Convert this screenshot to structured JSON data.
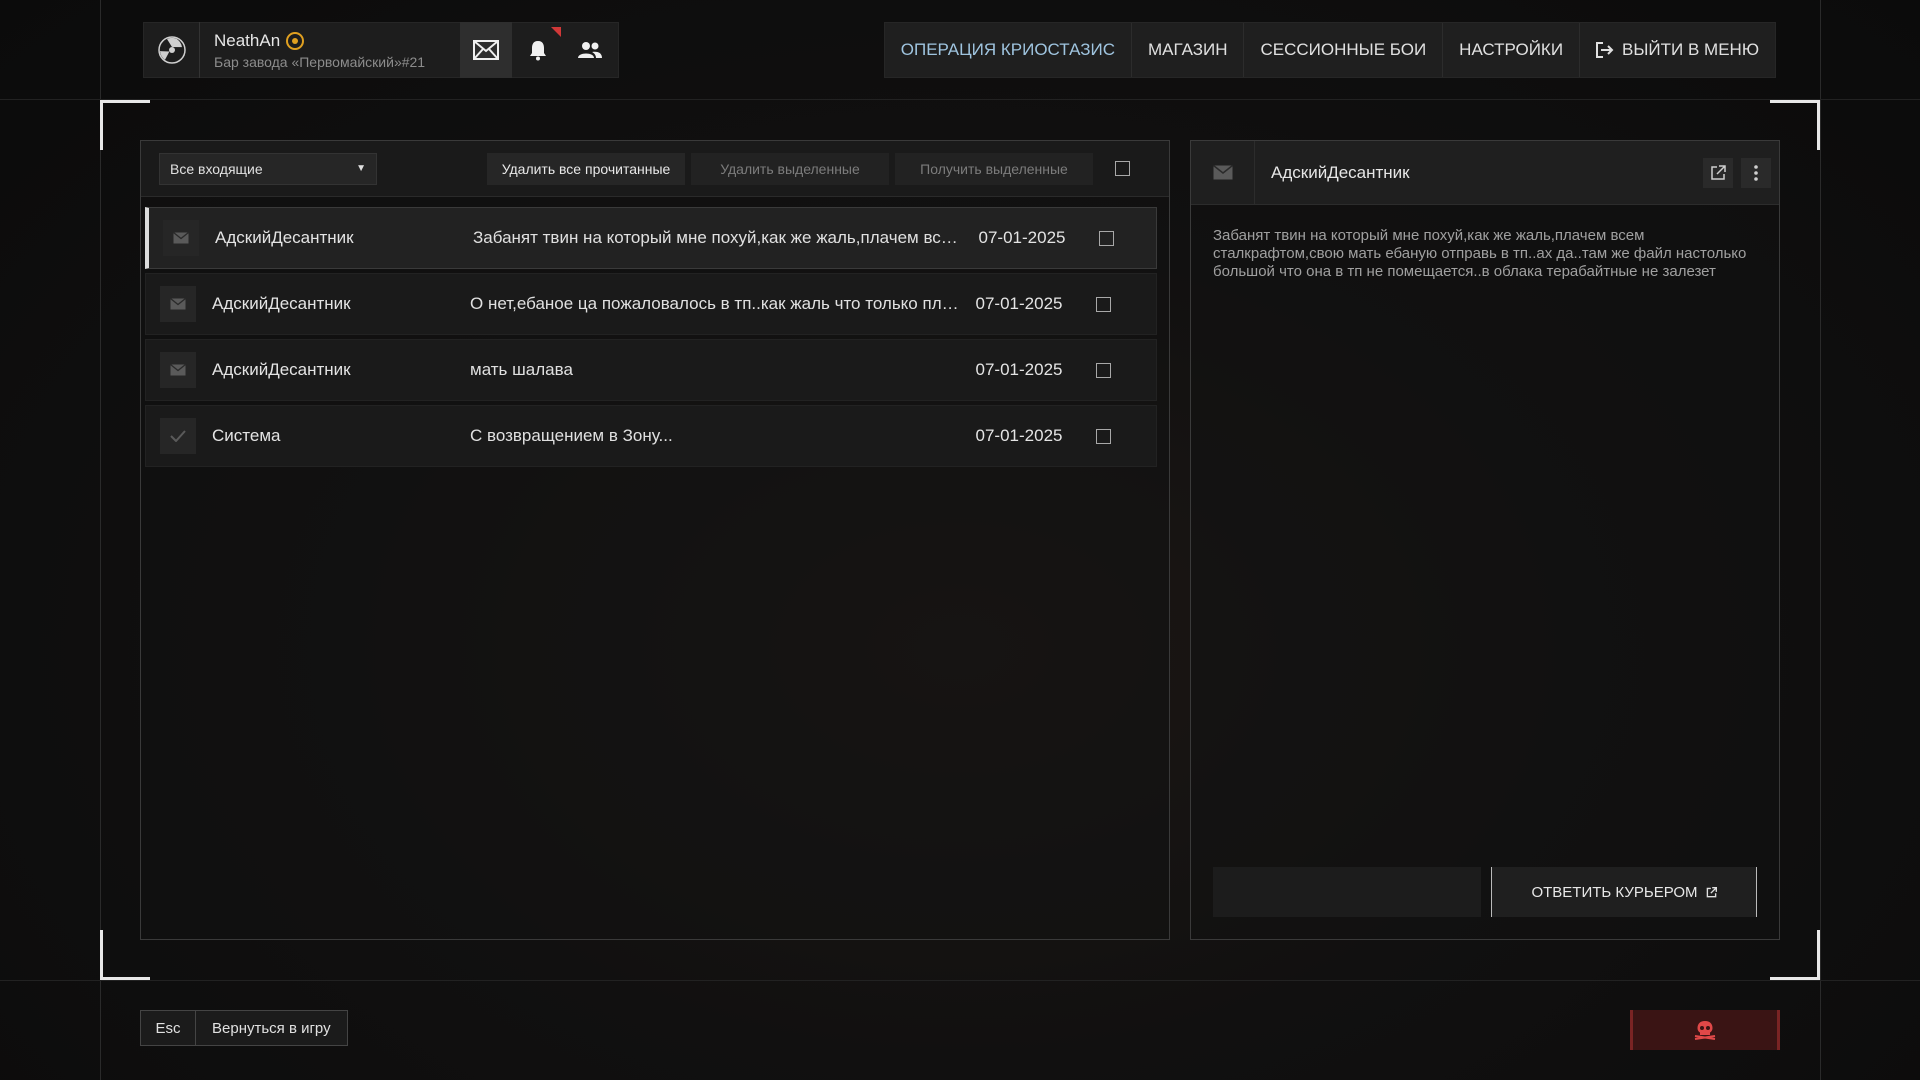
{
  "player": {
    "name": "NeathAn",
    "location": "Бар завода «Первомайский»#21"
  },
  "topnav": [
    {
      "label": "ОПЕРАЦИЯ КРИОСТАЗИС"
    },
    {
      "label": "МАГАЗИН"
    },
    {
      "label": "СЕССИОННЫЕ БОИ"
    },
    {
      "label": "НАСТРОЙКИ"
    },
    {
      "label": "ВЫЙТИ В МЕНЮ"
    }
  ],
  "toolbar": {
    "filter_value": "Все входящие",
    "delete_read_label": "Удалить все прочитанные",
    "delete_selected_label": "Удалить выделенные",
    "get_selected_label": "Получить выделенные"
  },
  "messages": [
    {
      "sender": "АдскийДесантник",
      "subject": "Забанят твин на который мне похуй,как же жаль,плачем всем..",
      "date": "07-01-2025",
      "icon": "envelope-icon"
    },
    {
      "sender": "АдскийДесантник",
      "subject": "О нет,ебаное ца пожаловалось в тп..как жаль что только плака..",
      "date": "07-01-2025",
      "icon": "envelope-icon"
    },
    {
      "sender": "АдскийДесантник",
      "subject": "мать шалава",
      "date": "07-01-2025",
      "icon": "envelope-icon"
    },
    {
      "sender": "Система",
      "subject": "С возвращением в Зону...",
      "date": "07-01-2025",
      "icon": "check-icon"
    }
  ],
  "reader": {
    "from": "АдскийДесантник",
    "body": "Забанят твин на который мне похуй,как же жаль,плачем всем сталкрафтом,свою мать ебаную отправь в тп..ах да..там же файл настолько большой что она в тп не помещается..в облака терабайтные не залезет",
    "reply_label": "ОТВЕТИТЬ КУРЬЕРОМ"
  },
  "bottom": {
    "esc_key": "Esc",
    "back_label": "Вернуться в игру"
  },
  "colors": {
    "accent_nav": "#9fc4df",
    "danger": "#d03838",
    "badge": "#e0a020"
  }
}
